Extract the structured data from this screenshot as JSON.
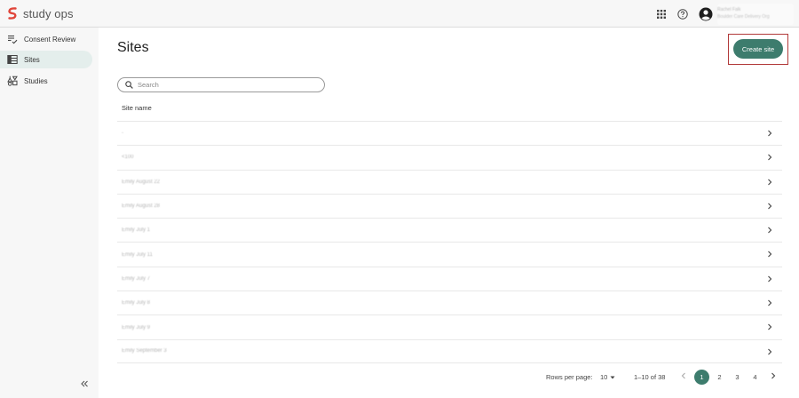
{
  "app": {
    "name": "study ops",
    "brand_color": "#e0453a",
    "accent": "#3d7c6d"
  },
  "header": {
    "icons": [
      "apps-grid-icon",
      "help-icon",
      "account-icon"
    ],
    "user": {
      "name": "Rachel Falk",
      "org": "Boulder Care Delivery Org"
    }
  },
  "sidebar": {
    "items": [
      {
        "label": "Consent Review",
        "icon": "checklist-icon",
        "active": false
      },
      {
        "label": "Sites",
        "icon": "table-icon",
        "active": true
      },
      {
        "label": "Studies",
        "icon": "studies-icon",
        "active": false
      }
    ],
    "collapse_icon": "double-chevron-left-icon"
  },
  "main": {
    "title": "Sites",
    "create_label": "Create site",
    "search_placeholder": "Search",
    "column_header": "Site name",
    "rows": [
      {
        "name": "-"
      },
      {
        "name": "<100"
      },
      {
        "name": "Emily August 22"
      },
      {
        "name": "Emily August 28"
      },
      {
        "name": "Emily July 1"
      },
      {
        "name": "Emily July 11"
      },
      {
        "name": "Emily July 7"
      },
      {
        "name": "Emily July 8"
      },
      {
        "name": "Emily July 9"
      },
      {
        "name": "Emily September 3"
      }
    ]
  },
  "pagination": {
    "rows_label": "Rows per page:",
    "rows_value": "10",
    "range": "1–10 of 38",
    "pages": [
      "1",
      "2",
      "3",
      "4"
    ],
    "current": "1"
  }
}
